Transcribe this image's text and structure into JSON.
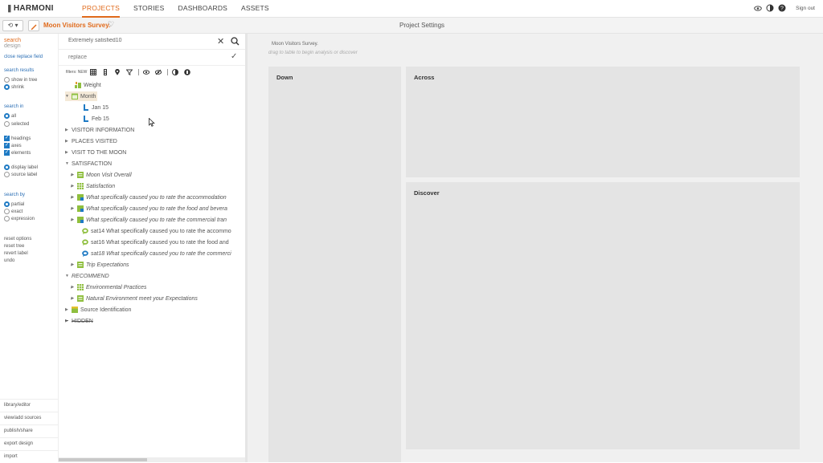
{
  "topbar": {
    "logo": "HARMONI",
    "nav": [
      "PROJECTS",
      "STORIES",
      "DASHBOARDS",
      "ASSETS"
    ],
    "active_nav": "PROJECTS",
    "signout": "Sign out"
  },
  "bar2": {
    "history_label": "⟲ ▾",
    "project_name": "Moon Visitors Survey.",
    "heart": "♡",
    "title": "Project Settings"
  },
  "left": {
    "tab_search": "search",
    "tab_design": "design",
    "close_replace": "close replace field",
    "search_results_head": "search results",
    "opt_show_in_tree": "show in tree",
    "opt_shrink": "shrink",
    "search_in_head": "search in",
    "opt_all": "all",
    "opt_selected": "selected",
    "chk_headings": "headings",
    "chk_axes": "axes",
    "chk_elements": "elements",
    "opt_display_label": "display label",
    "opt_source_label": "source label",
    "search_by_head": "search by",
    "opt_partial": "partial",
    "opt_exact": "exact",
    "opt_expression": "expression",
    "reset_options": "reset options",
    "reset_tree": "reset tree",
    "revert_label": "revert label",
    "undo": "undo",
    "bottom": [
      "library/editor",
      "view/add sources",
      "publish/share",
      "export design",
      "import"
    ]
  },
  "search": {
    "value": "Extremely satisfied10",
    "replace_placeholder": "replace",
    "filters_label": "filters: NEW"
  },
  "tree": {
    "weight": "Weight",
    "month": "Month",
    "jan": "Jan 15",
    "feb": "Feb 15",
    "visitor_information": "VISITOR INFORMATION",
    "places_visited": "PLACES VISITED",
    "visit_moon": "VISIT TO THE MOON",
    "satisfaction": "SATISFACTION",
    "moon_visit_overall": "Moon Visit Overall",
    "satisfaction_item": "Satisfaction",
    "q_accommodation": "What specifically caused you to rate the accommodation",
    "q_food": "What specifically caused you to rate the food and bevera",
    "q_commercial": "What specifically caused you to rate the commercial tran",
    "sat14": "sat14 What specifically caused you to rate the accommo",
    "sat16": "sat16 What specifically caused you to rate the food and",
    "sat18": "sat18 What specifically caused you to rate the commerci",
    "trip_expectations": "Trip Expectations",
    "recommend": "RECOMMEND",
    "environmental_practices": "Environmental Practices",
    "natural_environment": "Natural Environment meet your Expectations",
    "source_identification": "Source Identification",
    "hidden": "HIDDEN"
  },
  "main": {
    "title": "Moon Visitors Survey.",
    "hint": "drag to table to begin analysis or discover",
    "down": "Down",
    "across": "Across",
    "discover": "Discover"
  },
  "colors": {
    "accent": "#e06a1b",
    "link": "#2b6fb5",
    "check": "#1e7ac4"
  }
}
